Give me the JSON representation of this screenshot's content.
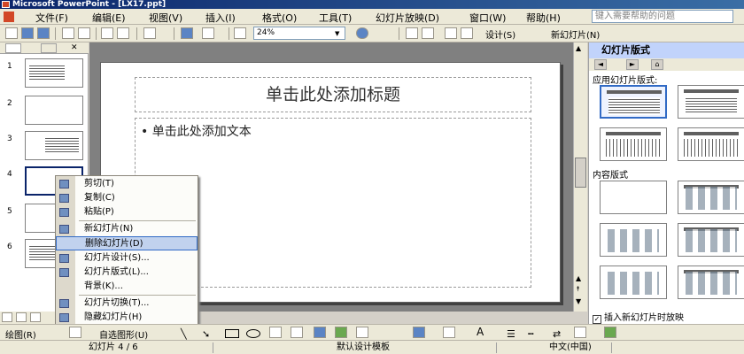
{
  "window": {
    "title": "Microsoft PowerPoint - [LX17.ppt]"
  },
  "menubar": {
    "items": [
      "文件(F)",
      "编辑(E)",
      "视图(V)",
      "插入(I)",
      "格式(O)",
      "工具(T)",
      "幻灯片放映(D)",
      "窗口(W)",
      "帮助(H)"
    ],
    "help_placeholder": "键入需要帮助的问题"
  },
  "toolbar": {
    "zoom": "24%",
    "design_label": "设计(S)",
    "new_slide_label": "新幻灯片(N)"
  },
  "thumbnails": {
    "numbers": [
      "1",
      "2",
      "3",
      "4",
      "5",
      "6"
    ],
    "selected": "4"
  },
  "slide": {
    "title_placeholder": "单击此处添加标题",
    "body_placeholder": "• 单击此处添加文本"
  },
  "task_pane": {
    "title": "幻灯片版式",
    "apply_label": "应用幻灯片版式:",
    "content_label": "内容版式",
    "checkbox_label": "插入新幻灯片时放映",
    "checkbox_checked": true
  },
  "context_menu": {
    "items": [
      "剪切(T)",
      "复制(C)",
      "粘贴(P)",
      "新幻灯片(N)",
      "删除幻灯片(D)",
      "幻灯片设计(S)...",
      "幻灯片版式(L)...",
      "背景(K)...",
      "幻灯片切换(T)...",
      "隐藏幻灯片(H)"
    ],
    "highlighted": "删除幻灯片(D)"
  },
  "drawbar": {
    "draw_label": "绘图(R)",
    "autoshape_label": "自选图形(U)"
  },
  "statusbar": {
    "slide_pos": "幻灯片 4 / 6",
    "template": "默认设计模板",
    "language": "中文(中国)"
  }
}
